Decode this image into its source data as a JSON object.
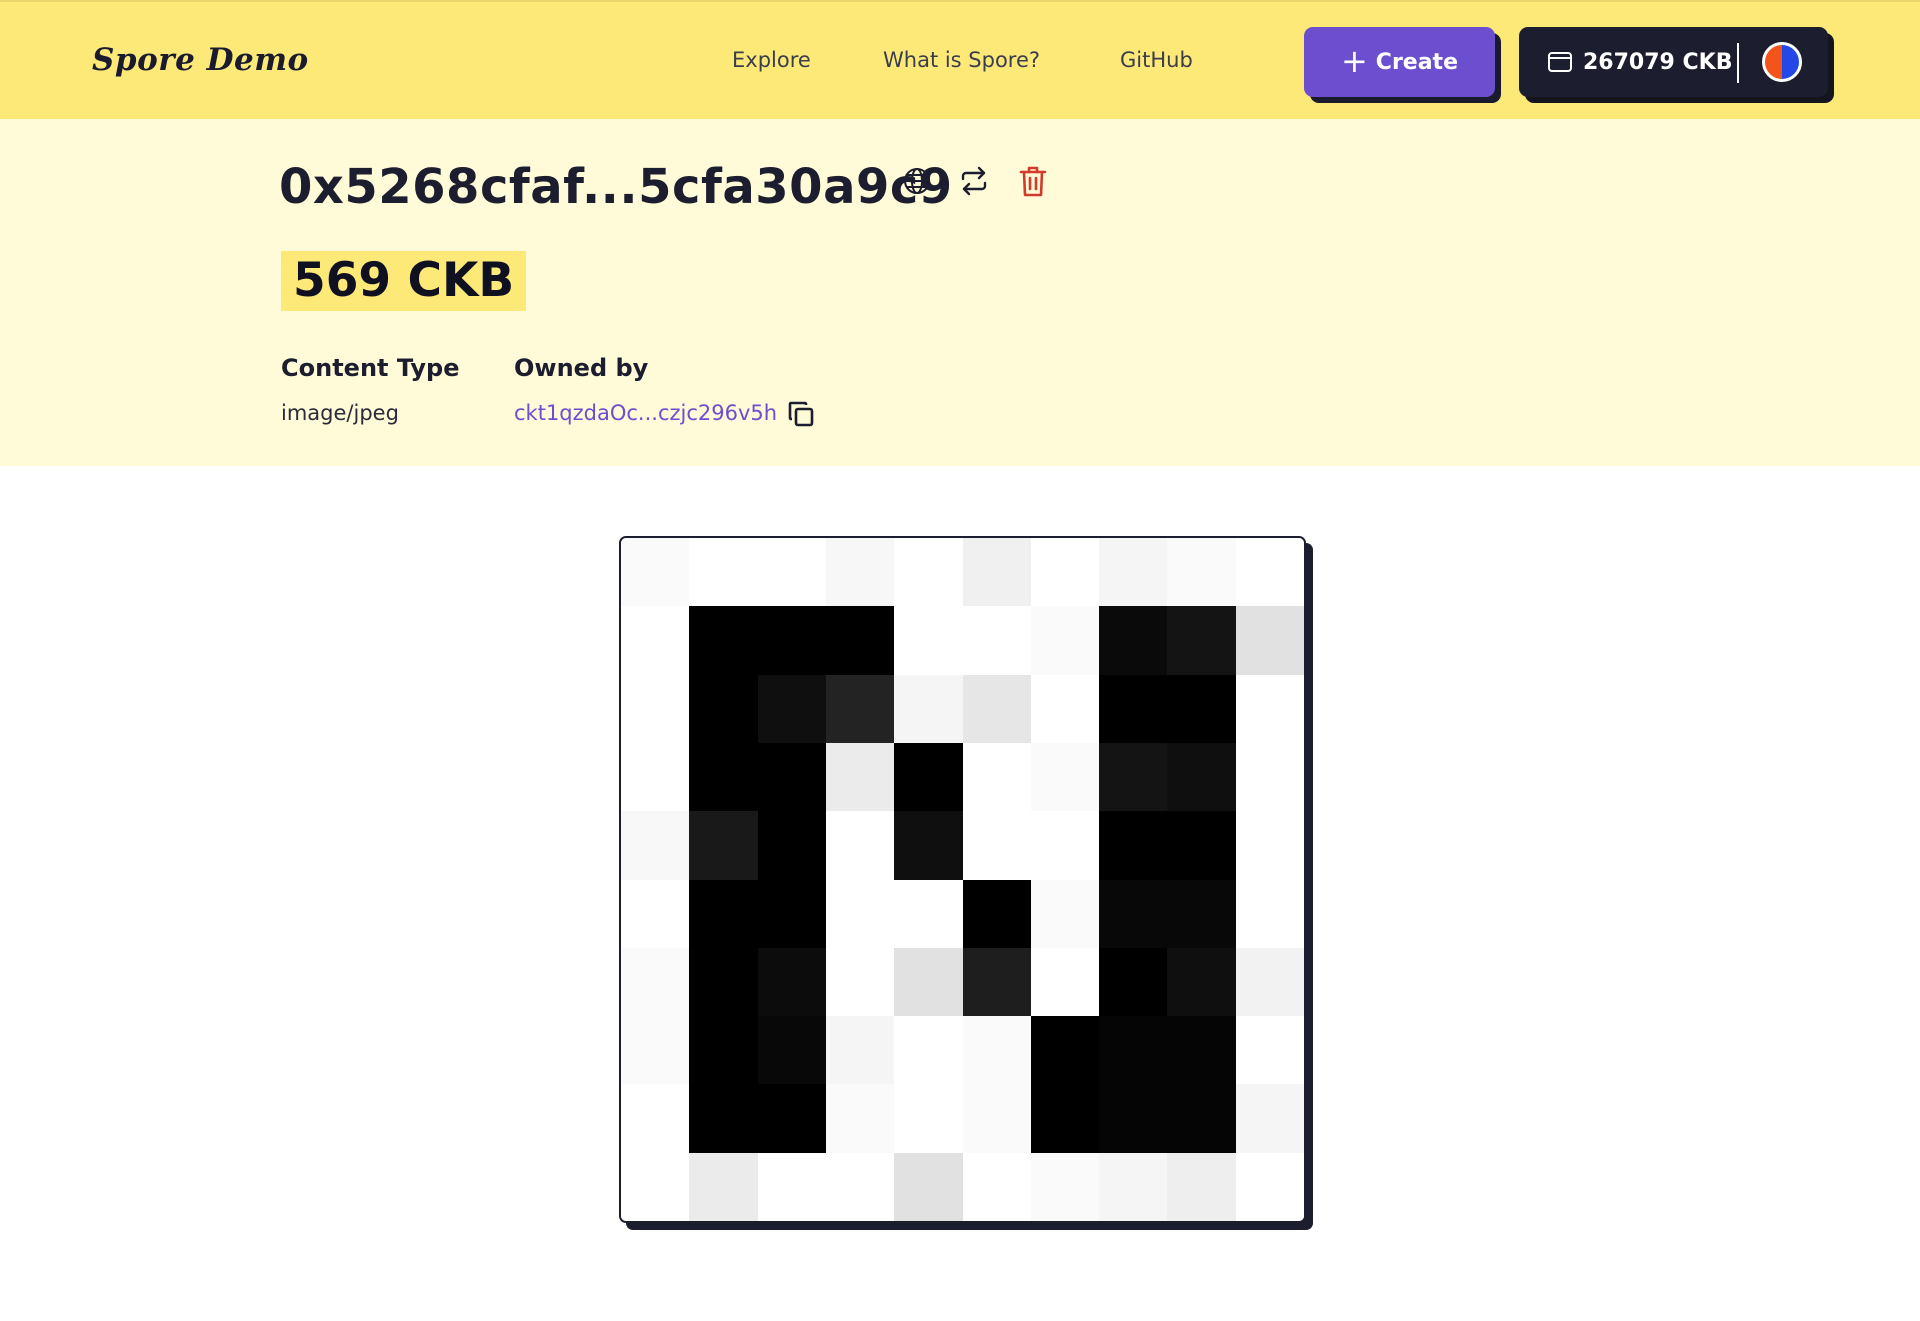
{
  "header": {
    "brand": "Spore Demo",
    "nav": [
      {
        "label": "Explore"
      },
      {
        "label": "What is Spore?"
      },
      {
        "label": "GitHub"
      }
    ],
    "create_label": "Create",
    "wallet_balance": "267079 CKB",
    "bg_color": "#fde978",
    "accent_color": "#6b4fcf"
  },
  "spore": {
    "id": "0x5268cfaf...5cfa30a9c9",
    "capacity": "569 CKB",
    "content_type_label": "Content Type",
    "content_type": "image/jpeg",
    "owner_label": "Owned by",
    "owner_address": "ckt1qzdaOc...czjc296v5h"
  },
  "image": {
    "pixels": [
      [
        250,
        255,
        255,
        247,
        255,
        240,
        255,
        245,
        250,
        255
      ],
      [
        255,
        0,
        0,
        0,
        255,
        255,
        250,
        10,
        20,
        225
      ],
      [
        255,
        0,
        15,
        35,
        245,
        230,
        255,
        0,
        0,
        255
      ],
      [
        255,
        0,
        0,
        235,
        0,
        255,
        250,
        20,
        15,
        255
      ],
      [
        248,
        25,
        0,
        255,
        15,
        255,
        255,
        0,
        0,
        255
      ],
      [
        255,
        0,
        0,
        255,
        255,
        0,
        250,
        8,
        8,
        255
      ],
      [
        250,
        0,
        12,
        255,
        225,
        30,
        255,
        0,
        15,
        242
      ],
      [
        250,
        0,
        8,
        245,
        255,
        250,
        0,
        5,
        5,
        255
      ],
      [
        255,
        0,
        0,
        250,
        255,
        250,
        0,
        5,
        5,
        245
      ],
      [
        255,
        235,
        255,
        255,
        225,
        255,
        250,
        245,
        238,
        255
      ]
    ]
  }
}
